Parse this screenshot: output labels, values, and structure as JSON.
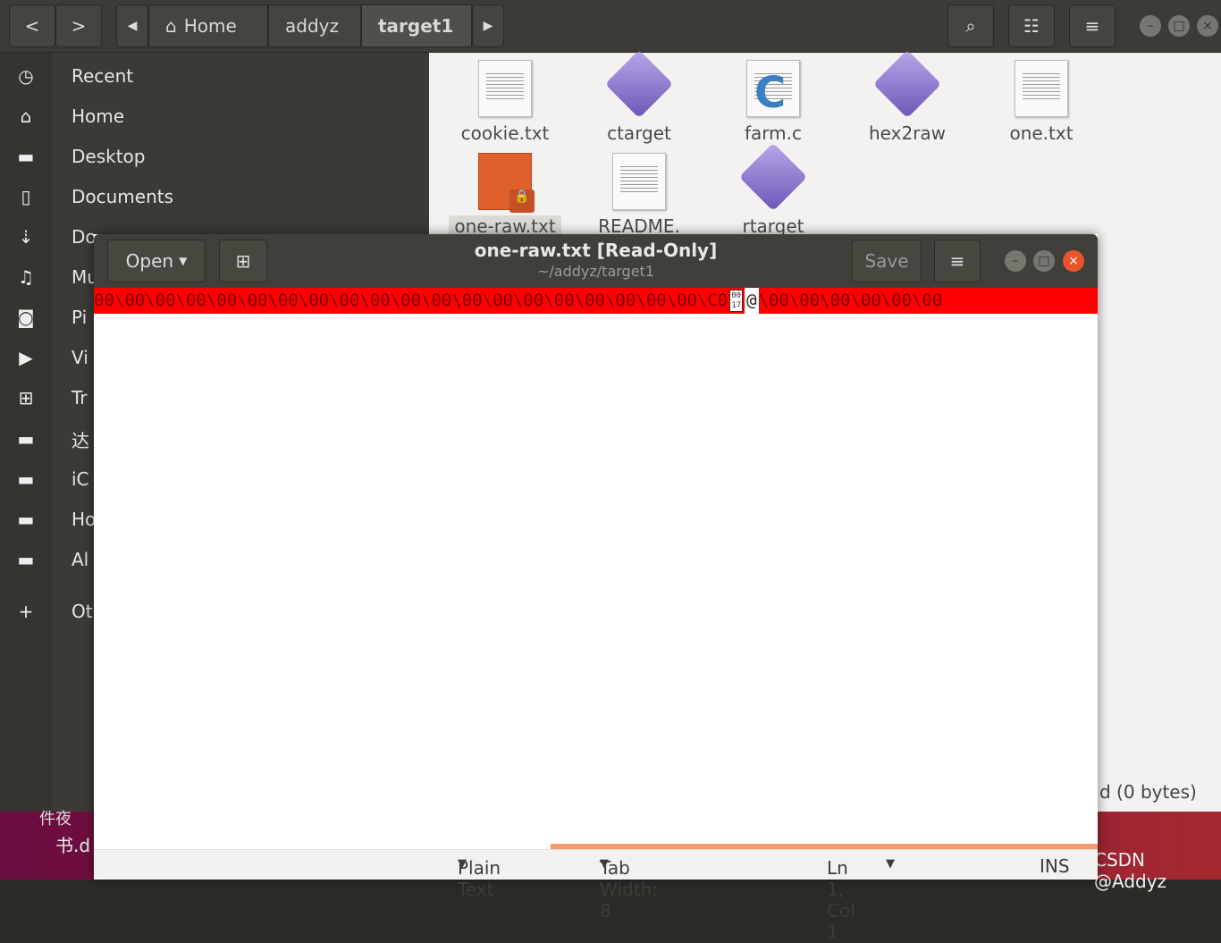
{
  "header": {
    "breadcrumbs": [
      "Home",
      "addyz",
      "target1"
    ],
    "active": "target1"
  },
  "sidebar": {
    "items": [
      {
        "label": "Recent",
        "icon": "clock-icon",
        "glyph": "◷"
      },
      {
        "label": "Home",
        "icon": "home-icon",
        "glyph": "⌂"
      },
      {
        "label": "Desktop",
        "icon": "folder-icon",
        "glyph": "▬"
      },
      {
        "label": "Documents",
        "icon": "document-icon",
        "glyph": "▯"
      },
      {
        "label": "Do",
        "icon": "download-icon",
        "glyph": "⇣"
      },
      {
        "label": "Mu",
        "icon": "music-icon",
        "glyph": "♫"
      },
      {
        "label": "Pi",
        "icon": "camera-icon",
        "glyph": "◙"
      },
      {
        "label": "Vi",
        "icon": "video-icon",
        "glyph": "▶"
      },
      {
        "label": "Tr",
        "icon": "trash-icon",
        "glyph": "⊞"
      },
      {
        "label": "达",
        "icon": "drive-icon",
        "glyph": "▬"
      },
      {
        "label": "iC",
        "icon": "drive-icon",
        "glyph": "▬"
      },
      {
        "label": "Ho",
        "icon": "drive-icon",
        "glyph": "▬"
      },
      {
        "label": "Al",
        "icon": "drive-icon",
        "glyph": "▬"
      },
      {
        "label": "Ot",
        "icon": "plus-icon",
        "glyph": "+"
      }
    ]
  },
  "files": [
    {
      "name": "cookie.txt",
      "type": "text"
    },
    {
      "name": "ctarget",
      "type": "exec"
    },
    {
      "name": "farm.c",
      "type": "c"
    },
    {
      "name": "hex2raw",
      "type": "exec"
    },
    {
      "name": "one.txt",
      "type": "text"
    },
    {
      "name": "one-raw.txt",
      "type": "locked"
    },
    {
      "name": "README.",
      "type": "text"
    },
    {
      "name": "rtarget",
      "type": "exec"
    }
  ],
  "files_status": "d  (0 bytes)",
  "desktop": {
    "label1": "件夜",
    "label2": "书.d",
    "watermark": "CSDN @Addyz"
  },
  "editor": {
    "open_label": "Open",
    "title": "one-raw.txt [Read-Only]",
    "path": "~/addyz/target1",
    "save_label": "Save",
    "line_before": "00\\00\\00\\00\\00\\00\\00\\00\\00\\00\\00\\00\\00\\00\\00\\00\\00\\00\\00\\00\\C0",
    "unknown_glyph": "0017",
    "box_top": "00",
    "box_bottom": "17",
    "at": "@",
    "line_after": "\\00\\00\\00\\00\\00\\00",
    "highlight_color": "#ff0000",
    "status": {
      "language": "Plain Text",
      "tab_width": "Tab Width: 8",
      "position": "Ln 1, Col 1",
      "mode": "INS"
    }
  }
}
